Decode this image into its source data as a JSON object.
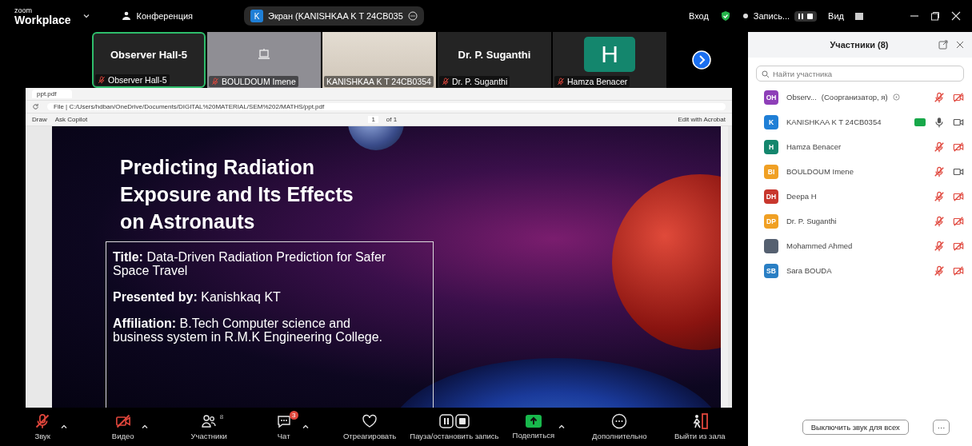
{
  "top_bar": {
    "logo_small": "zoom",
    "logo": "Workplace",
    "meeting_label": "Конференция",
    "share_initial": "K",
    "share_pill": "Экран (KANISHKAA K T 24CB035",
    "signin": "Вход",
    "recording": "Запись...",
    "view": "Вид"
  },
  "video_strip": [
    {
      "kind": "name",
      "title": "Observer  Hall-5",
      "label": "Observer  Hall-5",
      "mic_muted": true,
      "active": true
    },
    {
      "kind": "icon",
      "label": "BOULDOUM Imene",
      "mic_muted": true,
      "active": false
    },
    {
      "kind": "photo",
      "label": "KANISHKAA K T 24CB0354",
      "mic_muted": false,
      "active": false
    },
    {
      "kind": "name",
      "title": "Dr. P. Suganthi",
      "label": "Dr. P. Suganthi",
      "mic_muted": true,
      "active": false
    },
    {
      "kind": "avatar",
      "initial": "H",
      "label": "Hamza Benacer",
      "mic_muted": true,
      "active": false
    }
  ],
  "browser": {
    "tab_title": "ppt.pdf",
    "address": "File | C:/Users/hdban/OneDrive/Documents/DIGITAL%20MATERIAL/SEM%202/MATHS/ppt.pdf",
    "draw": "Draw",
    "copilot": "Ask Copilot",
    "page": "1",
    "page_total": "of 1",
    "acrobat": "Edit with Acrobat"
  },
  "slide": {
    "title": "Predicting Radiation Exposure and Its Effects on Astronauts",
    "paragraphs": [
      "**Title:** Data-Driven Radiation Prediction for Safer Space Travel",
      "**Presented by:** Kanishkaq KT",
      "**Affiliation:** B.Tech Computer science and business system in R.M.K Engineering College."
    ]
  },
  "toolbar": [
    {
      "kind": "mic",
      "label": "Звук",
      "muted": true,
      "caret": true
    },
    {
      "kind": "video",
      "label": "Видео",
      "muted": true,
      "caret": true
    },
    {
      "kind": "participants",
      "label": "Участники",
      "count": "8",
      "caret": false
    },
    {
      "kind": "chat",
      "label": "Чат",
      "badge": "3",
      "caret": true
    },
    {
      "kind": "react",
      "label": "Отреагировать",
      "caret": false
    },
    {
      "kind": "record",
      "label": "Пауза/остановить запись",
      "caret": false
    },
    {
      "kind": "share",
      "label": "Поделиться",
      "caret": true
    },
    {
      "kind": "more",
      "label": "Дополнительно",
      "caret": false
    },
    {
      "kind": "leave",
      "label": "Выйти из зала",
      "caret": false
    }
  ],
  "participants_panel": {
    "title": "Участники (8)",
    "search_placeholder": "Найти участника",
    "participants": [
      {
        "kind": "initials",
        "initials": "OH",
        "color": "#8e3fb8",
        "name": "Observ...",
        "role": "(Соорганизатор, я)",
        "mic_muted": true,
        "video_on": false,
        "sharing": false
      },
      {
        "kind": "initials",
        "initials": "K",
        "color": "#1f7fd6",
        "name": "KANISHKAA K T 24CB0354",
        "mic_muted": false,
        "video_on": true,
        "sharing": true
      },
      {
        "kind": "initials",
        "initials": "H",
        "color": "#14866d",
        "name": "Hamza Benacer",
        "mic_muted": true,
        "video_on": false,
        "sharing": false
      },
      {
        "kind": "initials",
        "initials": "BI",
        "color": "#f0a024",
        "name": "BOULDOUM Imene",
        "mic_muted": true,
        "video_on": true,
        "sharing": false
      },
      {
        "kind": "initials",
        "initials": "DH",
        "color": "#c8372d",
        "name": "Deepa H",
        "mic_muted": true,
        "video_on": false,
        "sharing": false
      },
      {
        "kind": "initials",
        "initials": "DP",
        "color": "#f0a024",
        "name": "Dr. P. Suganthi",
        "mic_muted": true,
        "video_on": false,
        "sharing": false
      },
      {
        "kind": "photo",
        "name": "Mohammed Ahmed",
        "mic_muted": true,
        "video_on": false,
        "sharing": false
      },
      {
        "kind": "initials",
        "initials": "SB",
        "color": "#2a7fc4",
        "name": "Sara BOUDA",
        "mic_muted": true,
        "video_on": false,
        "sharing": false
      }
    ],
    "mute_all": "Выключить звук для всех",
    "more": "···"
  }
}
